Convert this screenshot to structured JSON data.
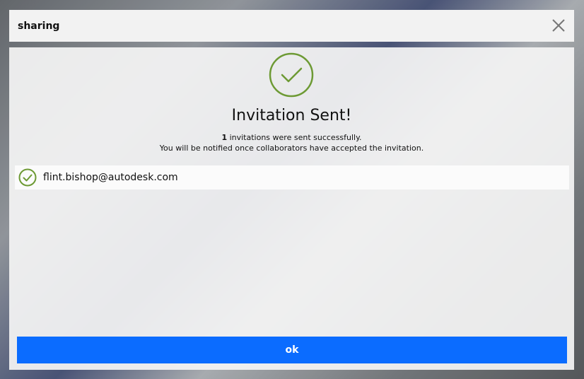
{
  "dialog": {
    "title": "sharing",
    "heading": "Invitation Sent!",
    "count": "1",
    "message_line1_rest": " invitations were sent successfully.",
    "message_line2": "You will be notified once collaborators have accepted the invitation.",
    "recipients": [
      {
        "email": "flint.bishop@autodesk.com",
        "status_icon": "check-circle-icon"
      }
    ],
    "ok_label": "ok"
  },
  "icons": {
    "close": "close-icon",
    "success": "check-circle-icon"
  },
  "colors": {
    "success_green": "#6d9a34",
    "primary_blue": "#0b6cff",
    "panel_bg": "#f4f4f4"
  }
}
